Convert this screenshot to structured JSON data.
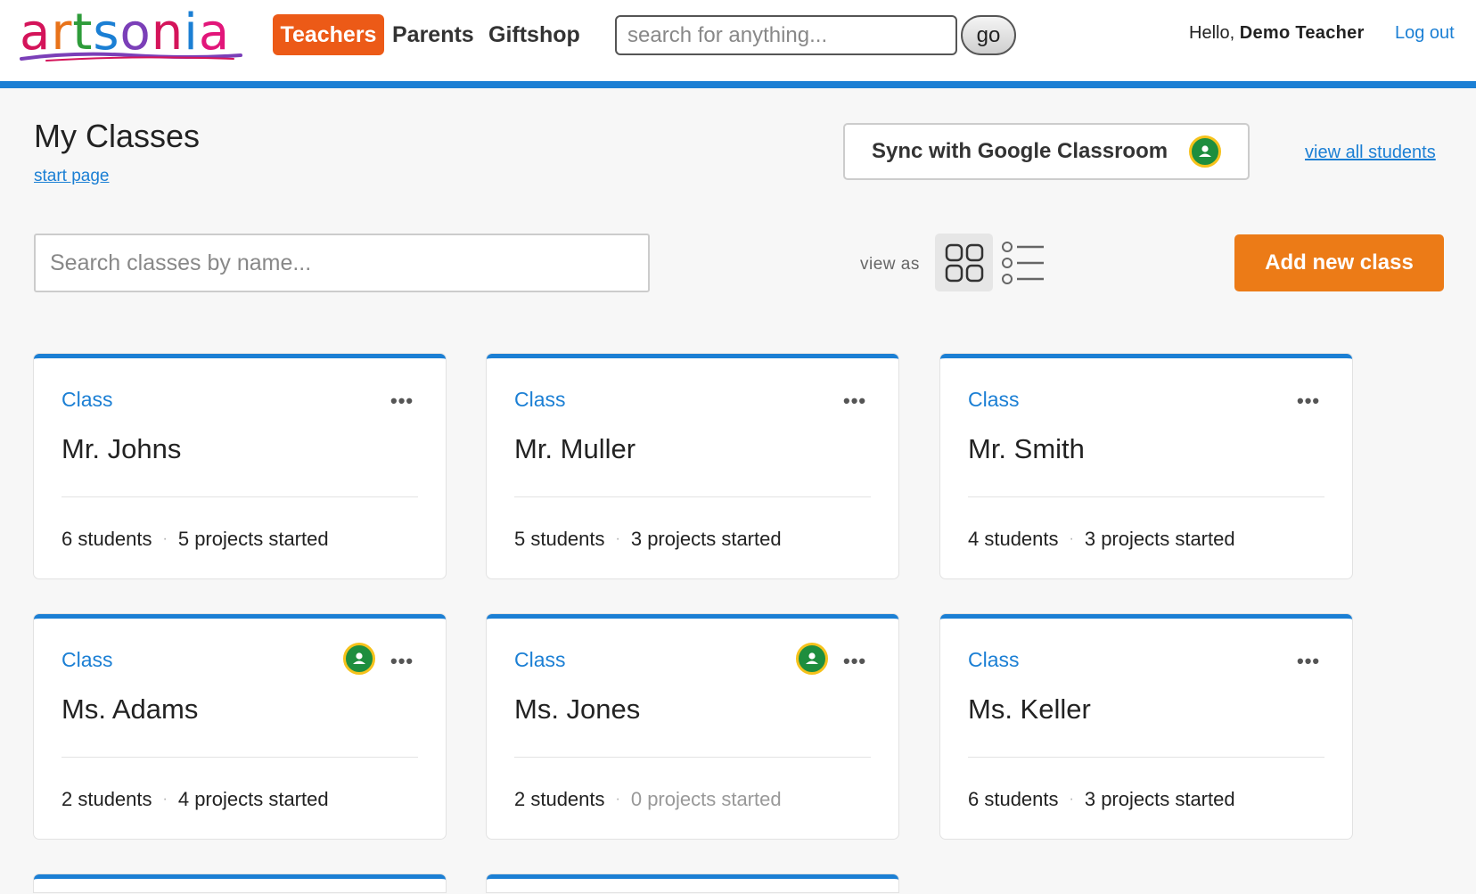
{
  "header": {
    "logo_text": "artsonia",
    "nav": {
      "teachers": "Teachers",
      "parents": "Parents",
      "giftshop": "Giftshop"
    },
    "search_placeholder": "search for anything...",
    "go_label": "go",
    "greeting": "Hello,",
    "user_name": "Demo Teacher",
    "logout_label": "Log out"
  },
  "page": {
    "title": "My Classes",
    "start_page_link": "start page",
    "sync_label": "Sync with Google Classroom",
    "view_all_label": "view all students",
    "class_search_placeholder": "Search classes by name...",
    "view_as_label": "view as",
    "add_class_label": "Add new class"
  },
  "colors": {
    "brand_blue": "#1b7fd4",
    "teachers_tab": "#ec5a17",
    "add_button": "#ec7b17",
    "google_green": "#1e8e3e"
  },
  "classes": [
    {
      "type": "Class",
      "name": "Mr. Johns",
      "students": "6 students",
      "projects": "5 projects started",
      "google": false,
      "projects_muted": false
    },
    {
      "type": "Class",
      "name": "Mr. Muller",
      "students": "5 students",
      "projects": "3 projects started",
      "google": false,
      "projects_muted": false
    },
    {
      "type": "Class",
      "name": "Mr. Smith",
      "students": "4 students",
      "projects": "3 projects started",
      "google": false,
      "projects_muted": false
    },
    {
      "type": "Class",
      "name": "Ms. Adams",
      "students": "2 students",
      "projects": "4 projects started",
      "google": true,
      "projects_muted": false
    },
    {
      "type": "Class",
      "name": "Ms. Jones",
      "students": "2 students",
      "projects": "0 projects started",
      "google": true,
      "projects_muted": true
    },
    {
      "type": "Class",
      "name": "Ms. Keller",
      "students": "6 students",
      "projects": "3 projects started",
      "google": false,
      "projects_muted": false
    }
  ],
  "icons": {
    "more": "more-options-icon",
    "google_classroom": "google-classroom-icon",
    "grid": "grid-view-icon",
    "list": "list-view-icon"
  }
}
